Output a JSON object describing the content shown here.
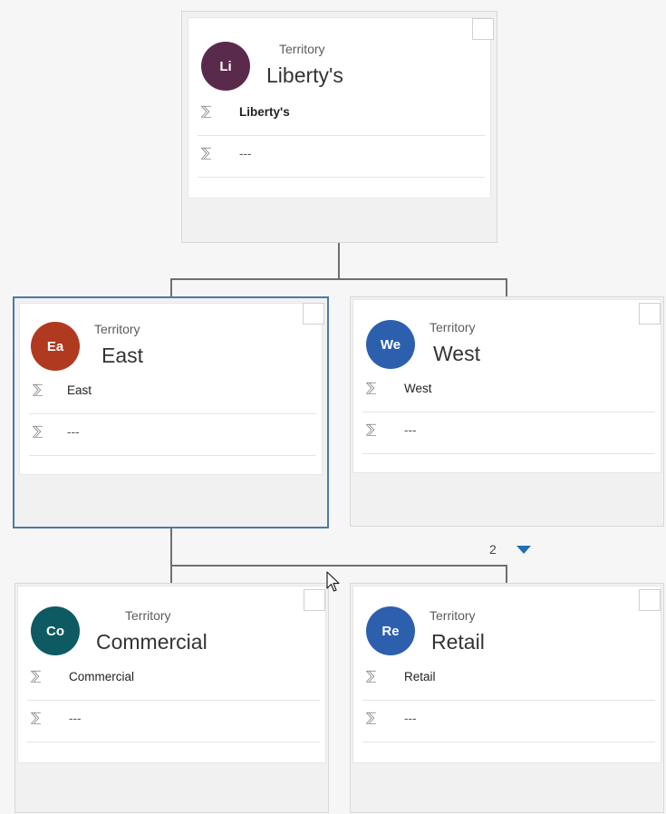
{
  "colors": {
    "liberty_avatar": "#5a2a4c",
    "east_avatar": "#b03a1f",
    "west_avatar": "#2c5fae",
    "commercial_avatar": "#0d5a63",
    "retail_avatar": "#2c5fae",
    "selected_border": "#4a7aaa",
    "expand_caret": "#1f6fb7"
  },
  "nodes": {
    "root": {
      "type_label": "Territory",
      "title": "Liberty's",
      "initials": "Li",
      "fields": [
        "Liberty's",
        "---"
      ]
    },
    "east": {
      "type_label": "Territory",
      "title": "East",
      "initials": "Ea",
      "fields": [
        "East",
        "---"
      ],
      "selected": true
    },
    "west": {
      "type_label": "Territory",
      "title": "West",
      "initials": "We",
      "fields": [
        "West",
        "---"
      ]
    },
    "commercial": {
      "type_label": "Territory",
      "title": "Commercial",
      "initials": "Co",
      "fields": [
        "Commercial",
        "---"
      ]
    },
    "retail": {
      "type_label": "Territory",
      "title": "Retail",
      "initials": "Re",
      "fields": [
        "Retail",
        "---"
      ]
    }
  },
  "children_count": "2",
  "field_icon": "sigma-icon",
  "expand_icon": "caret-down-icon",
  "pointer_icon": "mouse-pointer-icon"
}
